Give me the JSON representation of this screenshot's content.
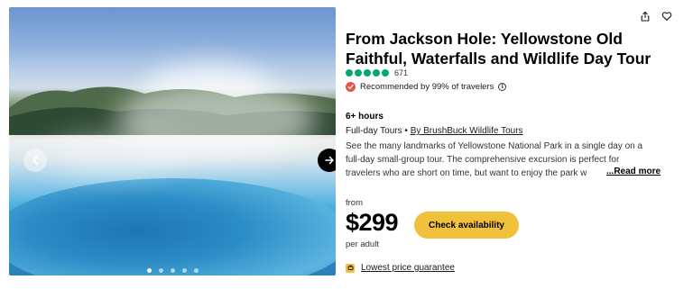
{
  "product": {
    "title": "From Jackson Hole: Yellowstone Old Faithful, Waterfalls and Wildlife Day Tour",
    "rating_bubbles": 5,
    "review_count": "671",
    "recommended": "Recommended by 99% of travelers",
    "duration": "6+ hours",
    "category": "Full-day Tours",
    "separator": " • ",
    "provider": "By BrushBuck Wildlife Tours",
    "description": [
      "See the many landmarks of Yellowstone National Park in a single day on a",
      "full-day small-group tour. The comprehensive excursion is perfect for",
      "travelers who are short on time, but want to enjoy the park w"
    ],
    "read_more": "...Read more"
  },
  "pricing": {
    "from_label": "from",
    "price": "$299",
    "per_label": "per adult",
    "cta": "Check availability",
    "guarantee": "Lowest price guarantee"
  },
  "gallery": {
    "slide_count": 5,
    "active_slide": 1,
    "prev_icon": "chevron-left-icon",
    "next_icon": "arrow-right-icon"
  },
  "icons": {
    "share": "share-icon",
    "favorite": "heart-icon"
  },
  "colors": {
    "rating": "#00aa6c",
    "cta": "#f2c13b",
    "badge": "#e0584b"
  }
}
